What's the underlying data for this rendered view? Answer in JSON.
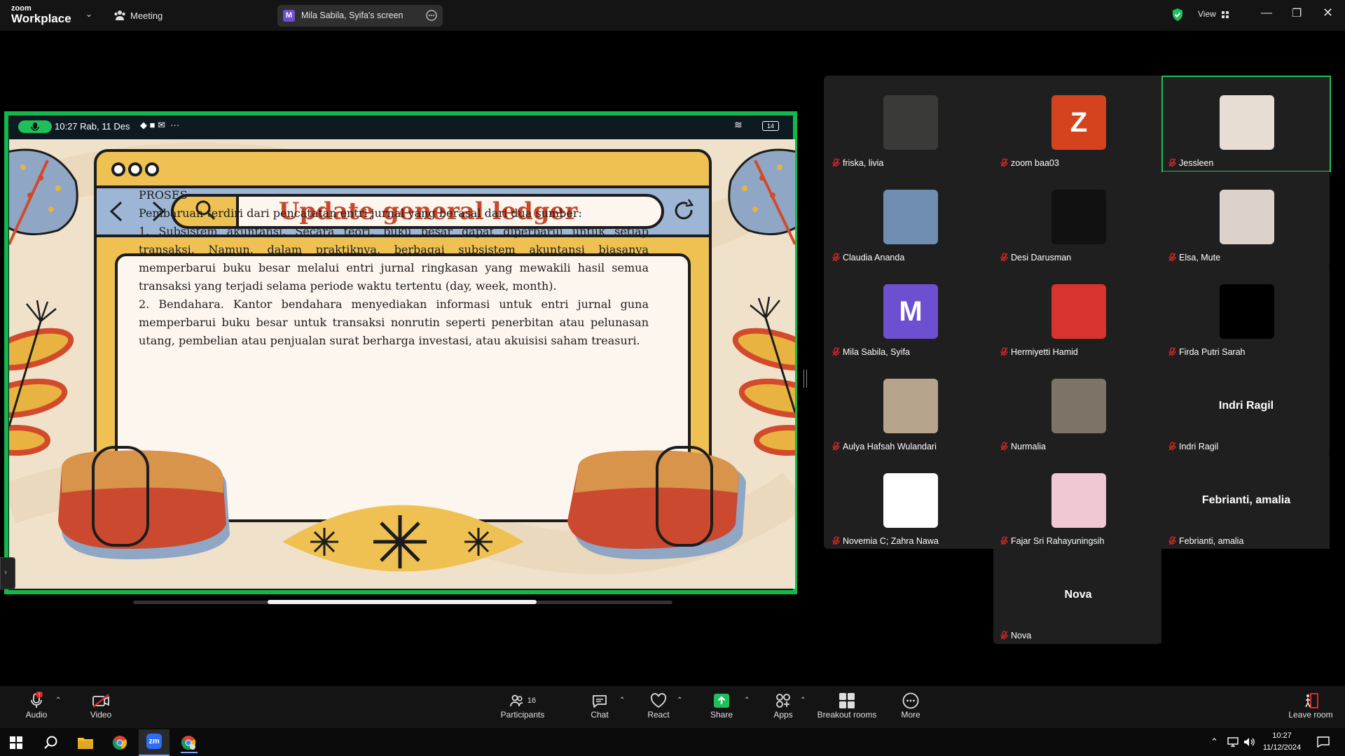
{
  "titlebar": {
    "brand_small": "zoom",
    "brand_big": "Workplace",
    "meeting_label": "Meeting",
    "share_badge": "M",
    "share_label": "Mila Sabila, Syifa's screen",
    "view_label": "View"
  },
  "tablet_status": {
    "time": "10:27 Rab, 11 Des",
    "battery": "14"
  },
  "slide": {
    "title": "Update general ledger",
    "heading": "PROSES",
    "line1": "Pembaruan terdiri dari pencatatan entri jurnal yang berasal dari dua sumber:",
    "item1": "1. Subsistem akuntansi. Secara teori, buku besar dapat diperbarui untuk setiap transaksi. Namun, dalam praktiknya, berbagai subsistem akuntansi biasanya memperbarui buku besar melalui entri jurnal ringkasan yang mewakili hasil semua transaksi yang terjadi selama periode waktu tertentu (day, week, month).",
    "item2": "2. Bendahara. Kantor bendahara menyediakan informasi untuk entri jurnal guna memperbarui buku besar untuk transaksi nonrutin seperti penerbitan atau pelunasan utang, pembelian atau penjualan surat berharga investasi, atau akuisisi saham treasuri."
  },
  "participants": [
    {
      "name": "friska, livia",
      "type": "photo",
      "color": "#3a3a38"
    },
    {
      "name": "zoom baa03",
      "type": "letter",
      "letter": "Z",
      "color": "#d4431e"
    },
    {
      "name": "Jessleen",
      "type": "photo",
      "color": "#e8ddd2",
      "active": true
    },
    {
      "name": "Claudia Ananda",
      "type": "photo",
      "color": "#6f8eb2"
    },
    {
      "name": "Desi Darusman",
      "type": "photo",
      "color": "#111111"
    },
    {
      "name": "Elsa, Mute",
      "type": "photo",
      "color": "#dcd2cc"
    },
    {
      "name": "Mila Sabila, Syifa",
      "type": "letter",
      "letter": "M",
      "color": "#6d4fd1"
    },
    {
      "name": "Hermiyetti Hamid",
      "type": "photo",
      "color": "#d8332e"
    },
    {
      "name": "Firda Putri Sarah",
      "type": "photo",
      "color": "#000000"
    },
    {
      "name": "Aulya Hafsah Wulandari",
      "type": "photo",
      "color": "#b7a48c"
    },
    {
      "name": "Nurmalia",
      "type": "photo",
      "color": "#7d7468"
    },
    {
      "name": "Indri Ragil",
      "type": "name",
      "bigname": "Indri Ragil"
    },
    {
      "name": "Novemia C; Zahra Nawa",
      "type": "photo",
      "color": "#ffffff"
    },
    {
      "name": "Fajar Sri Rahayuningsih",
      "type": "photo",
      "color": "#f0c8d4"
    },
    {
      "name": "Febrianti, amalia",
      "type": "name",
      "bigname": "Febrianti, amalia"
    },
    {
      "name": "Nova",
      "type": "name",
      "bigname": "Nova"
    }
  ],
  "toolbar": {
    "audio": "Audio",
    "video": "Video",
    "participants": "Participants",
    "participants_count": "16",
    "chat": "Chat",
    "react": "React",
    "share": "Share",
    "apps": "Apps",
    "breakout": "Breakout rooms",
    "more": "More",
    "leave": "Leave room"
  },
  "taskbar": {
    "time": "10:27",
    "date": "11/12/2024",
    "zoom_app": "zm"
  },
  "colors": {
    "share_border": "#12b84b",
    "accent_red": "#c7482c",
    "share_green": "#1fbf5a"
  }
}
